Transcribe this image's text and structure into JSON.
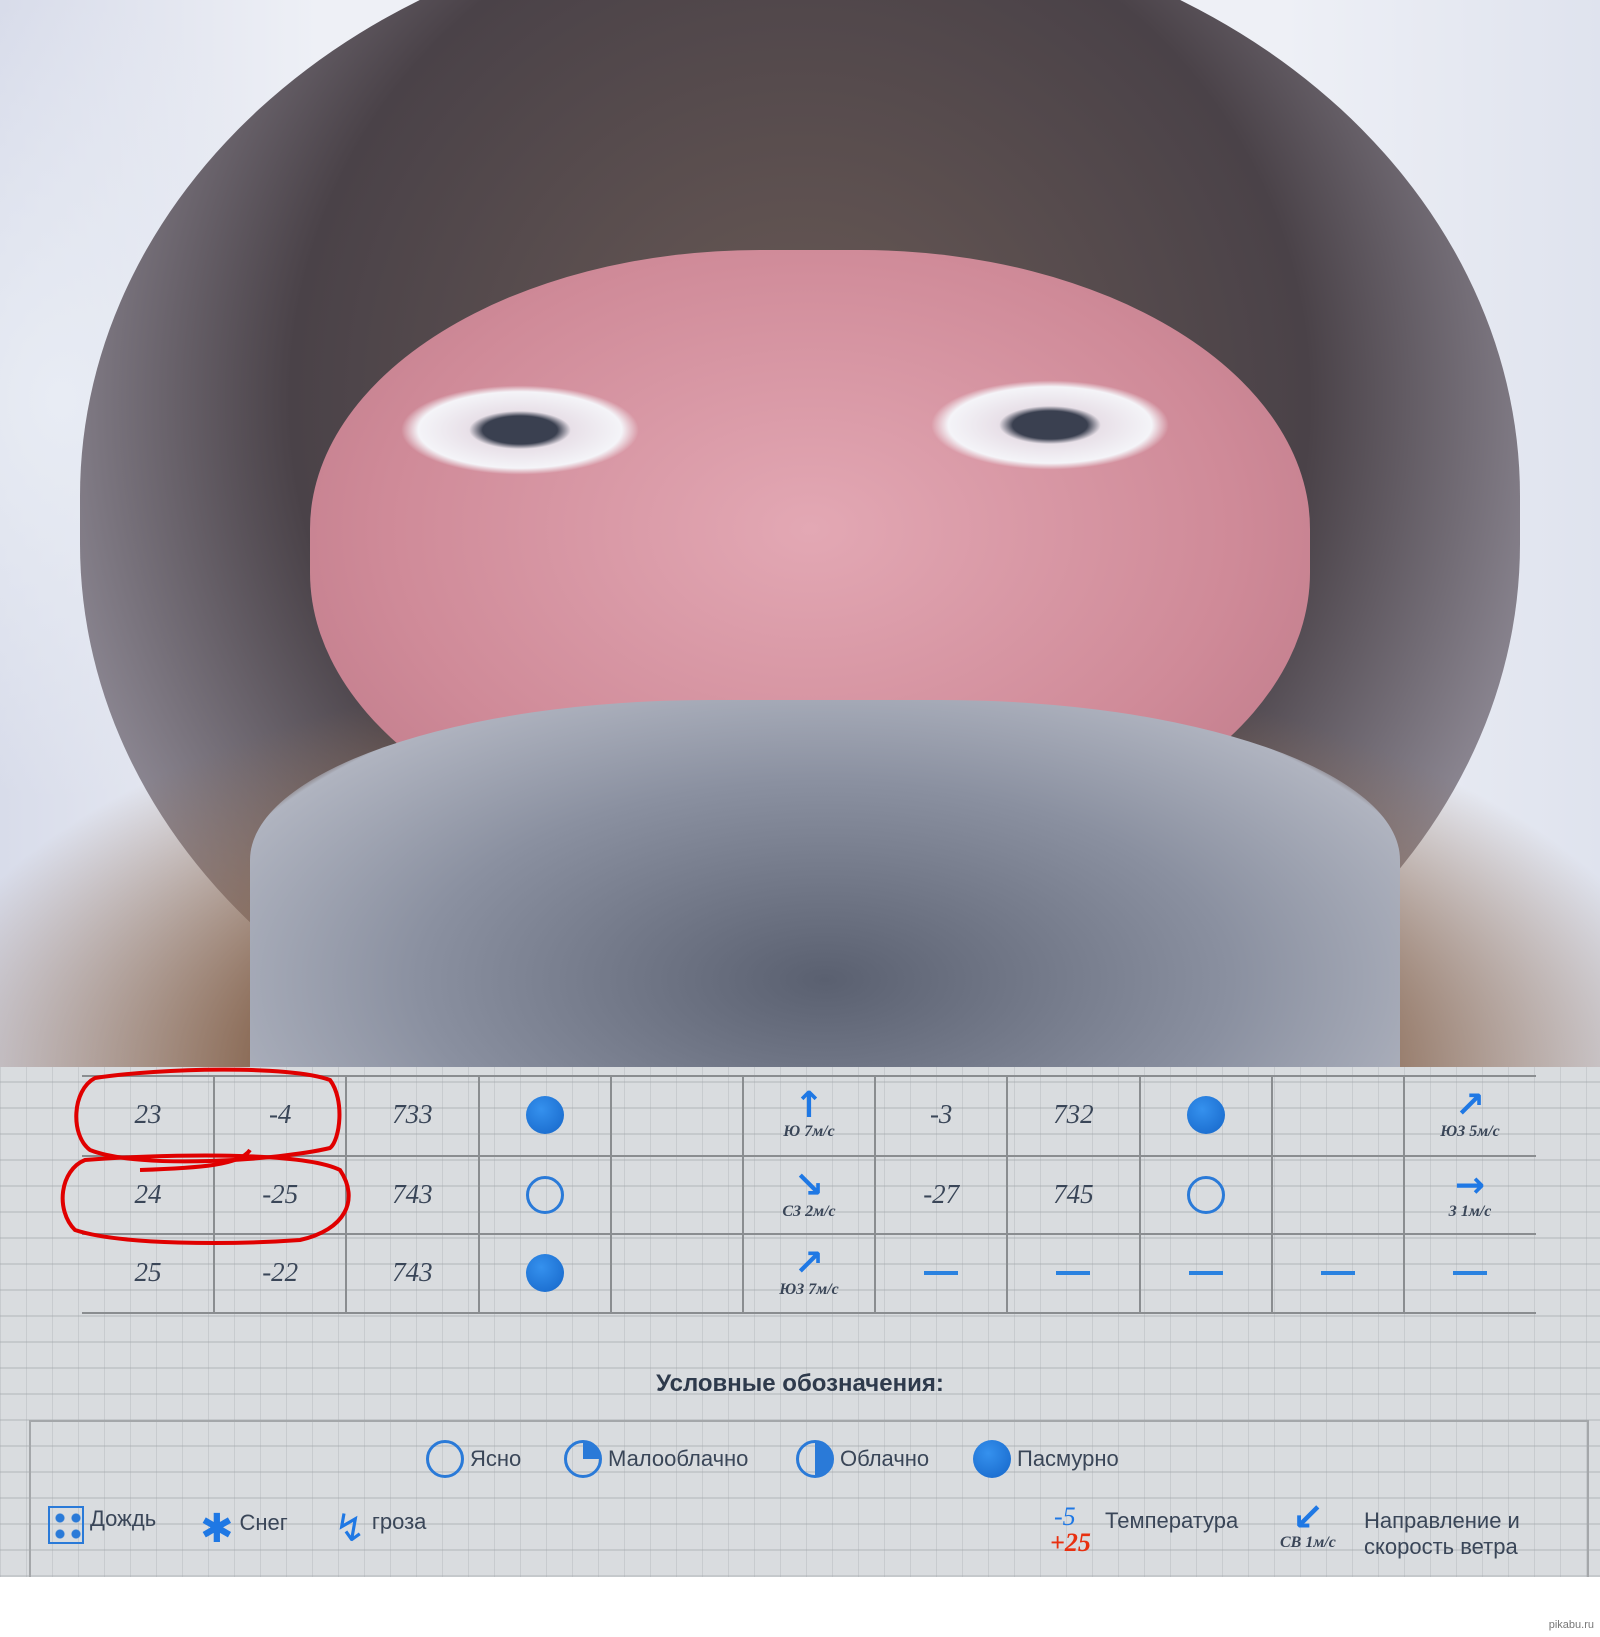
{
  "table": {
    "rows": [
      {
        "c1": "23",
        "c2": "-4",
        "c3": "733",
        "sky1": "overcast",
        "wind1_dir": "up",
        "wind1": "Ю 7м/с",
        "c7": "-3",
        "c8": "732",
        "sky2": "overcast",
        "wind2_dir": "up-right",
        "wind2": "ЮЗ 5м/с"
      },
      {
        "c1": "24",
        "c2": "-25",
        "c3": "743",
        "sky1": "clear",
        "wind1_dir": "down-right",
        "wind1": "СЗ 2м/с",
        "c7": "-27",
        "c8": "745",
        "sky2": "clear",
        "wind2_dir": "right",
        "wind2": "З 1м/с"
      },
      {
        "c1": "25",
        "c2": "-22",
        "c3": "743",
        "sky1": "overcast",
        "wind1_dir": "up-right",
        "wind1": "ЮЗ 7м/с",
        "c7": "—",
        "c8": "—",
        "sky2": "—",
        "wind2_dir": "—",
        "wind2": "—"
      }
    ]
  },
  "legend": {
    "title": "Условные обозначения:",
    "clear": "Ясно",
    "partly": "Малооблачно",
    "cloudy": "Облачно",
    "overcast": "Пасмурно",
    "rain": "Дождь",
    "snow": "Снег",
    "storm": "гроза",
    "temp_neg": "-5",
    "temp_pos": "+25",
    "temp_label": "Температура",
    "wind_sample": "СВ 1м/с",
    "wind_label_1": "Направление и",
    "wind_label_2": "скорость ветра"
  },
  "watermark": "pikabu.ru",
  "colors": {
    "accent": "#1f78e4",
    "annotation": "#e00000",
    "positive_temp": "#e83010"
  }
}
